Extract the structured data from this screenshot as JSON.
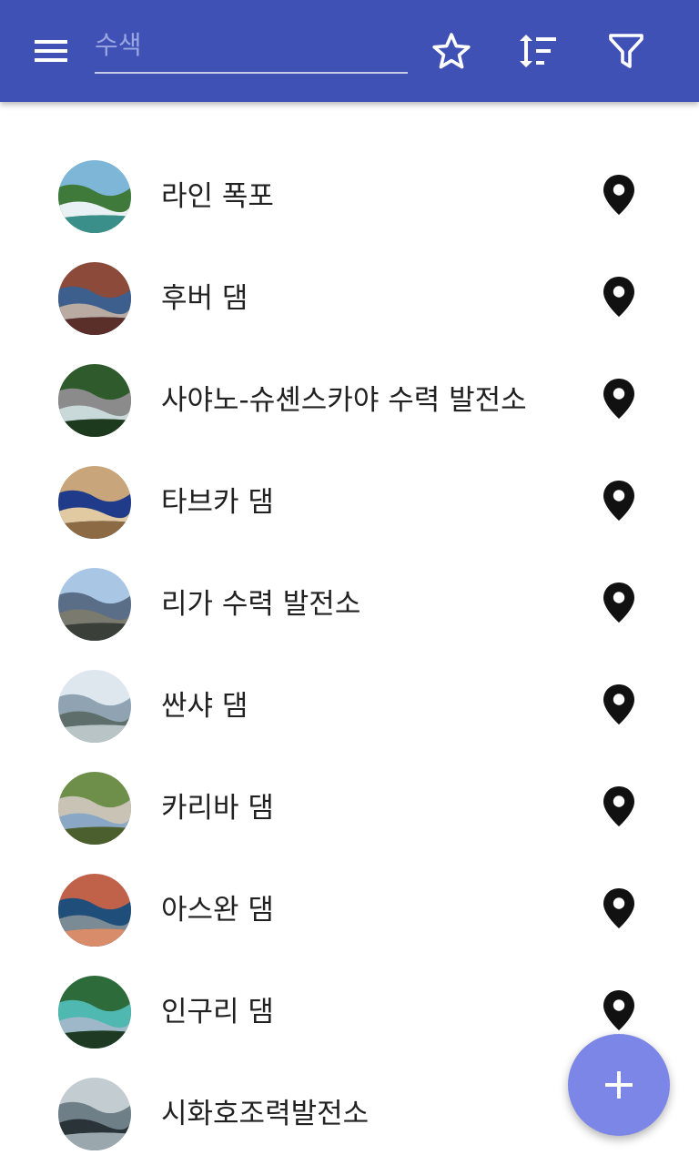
{
  "toolbar": {
    "background": "#3f51b5",
    "menu_icon": "hamburger-menu-icon",
    "search": {
      "value": "",
      "placeholder": "수색"
    },
    "actions": [
      {
        "icon": "star-outline-icon"
      },
      {
        "icon": "sort-icon"
      },
      {
        "icon": "filter-icon"
      }
    ]
  },
  "list": {
    "items": [
      {
        "label": "라인 폭포",
        "thumb": "waterfall",
        "colors": [
          "#7db6d6",
          "#3f7a3a",
          "#e9f1f4",
          "#3b8f8a"
        ]
      },
      {
        "label": "후버 댐",
        "thumb": "aerial",
        "colors": [
          "#8c4a3b",
          "#3d5f8d",
          "#b9aaa2",
          "#5a2f2a"
        ]
      },
      {
        "label": "사야노-슈셴스카야 수력 발전소",
        "thumb": "dam-wall",
        "colors": [
          "#2f5a2c",
          "#8b8b8b",
          "#c9d8d9",
          "#1e3a1e"
        ]
      },
      {
        "label": "타브카 댐",
        "thumb": "satellite",
        "colors": [
          "#c8a57a",
          "#1f3b8a",
          "#e1c9a1",
          "#8b6a44"
        ]
      },
      {
        "label": "리가 수력 발전소",
        "thumb": "bridge",
        "colors": [
          "#a9c6e5",
          "#5b6e87",
          "#7a7a6e",
          "#3b3f3a"
        ]
      },
      {
        "label": "싼샤 댐",
        "thumb": "dam-wide",
        "colors": [
          "#dfe7ee",
          "#8fa3b3",
          "#5e6e6a",
          "#b9c4c6"
        ]
      },
      {
        "label": "카리바 댐",
        "thumb": "arch-dam",
        "colors": [
          "#6e8f4a",
          "#c9c3b5",
          "#8aa8c6",
          "#4b5e2e"
        ]
      },
      {
        "label": "아스완 댐",
        "thumb": "delta",
        "colors": [
          "#c0624a",
          "#1f4e7a",
          "#7a8b96",
          "#d88c6a"
        ]
      },
      {
        "label": "인구리 댐",
        "thumb": "reservoir",
        "colors": [
          "#2e6b3a",
          "#4fb8b0",
          "#9fb8c9",
          "#1f3a22"
        ]
      },
      {
        "label": "시화호조력발전소",
        "thumb": "tidal",
        "colors": [
          "#c3ccd1",
          "#6f7f88",
          "#2a3338",
          "#9aa8ae"
        ]
      }
    ],
    "location_icon": "map-pin-icon"
  },
  "fab": {
    "icon": "plus-icon",
    "color": "#7b86e6"
  }
}
